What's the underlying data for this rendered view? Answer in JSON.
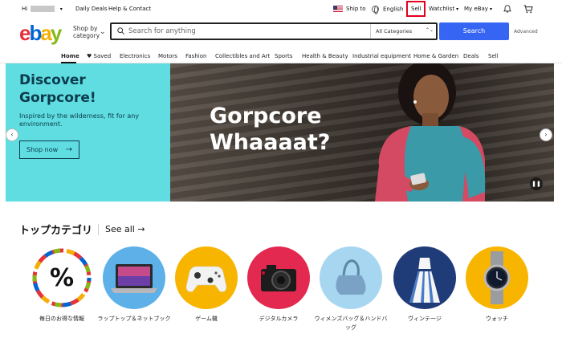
{
  "topbar": {
    "greeting": "Hi",
    "daily_deals": "Daily Deals",
    "help_contact": "Help & Contact",
    "ship_to": "Ship to",
    "language": "English",
    "sell": "Sell",
    "watchlist": "Watchlist",
    "my_ebay": "My eBay"
  },
  "header": {
    "logo_letters": [
      "e",
      "b",
      "a",
      "y"
    ],
    "shop_by_category": "Shop by category",
    "search_placeholder": "Search for anything",
    "category_select": "All Categories",
    "search_button": "Search",
    "advanced": "Advanced"
  },
  "nav": {
    "items": [
      "Home",
      "Saved",
      "Electronics",
      "Motors",
      "Fashion",
      "Collectibles and Art",
      "Sports",
      "Health & Beauty",
      "Industrial equipment",
      "Home & Garden",
      "Deals",
      "Sell"
    ]
  },
  "hero": {
    "title": "Discover Gorpcore!",
    "subtitle": "Inspired by the wilderness, fit for any environment.",
    "button": "Shop now",
    "headline": "Gorpcore Whaaaat?"
  },
  "top_categories": {
    "title": "トップカテゴリ",
    "see_all": "See all",
    "items": [
      {
        "label": "毎日のお得な情報",
        "icon": "percent-icon"
      },
      {
        "label": "ラップトップ＆ネットブック",
        "icon": "laptop-icon"
      },
      {
        "label": "ゲーム機",
        "icon": "game-controller-icon"
      },
      {
        "label": "デジタルカメラ",
        "icon": "camera-icon"
      },
      {
        "label": "ウィメンズバッグ＆ハンドバッグ",
        "icon": "handbag-icon"
      },
      {
        "label": "ヴィンテージ",
        "icon": "dress-icon"
      },
      {
        "label": "ウォッチ",
        "icon": "watch-icon"
      }
    ]
  },
  "colors": {
    "search_button": "#3665f3",
    "hero_panel": "#5fdde0",
    "highlight_box": "#e3001b"
  }
}
